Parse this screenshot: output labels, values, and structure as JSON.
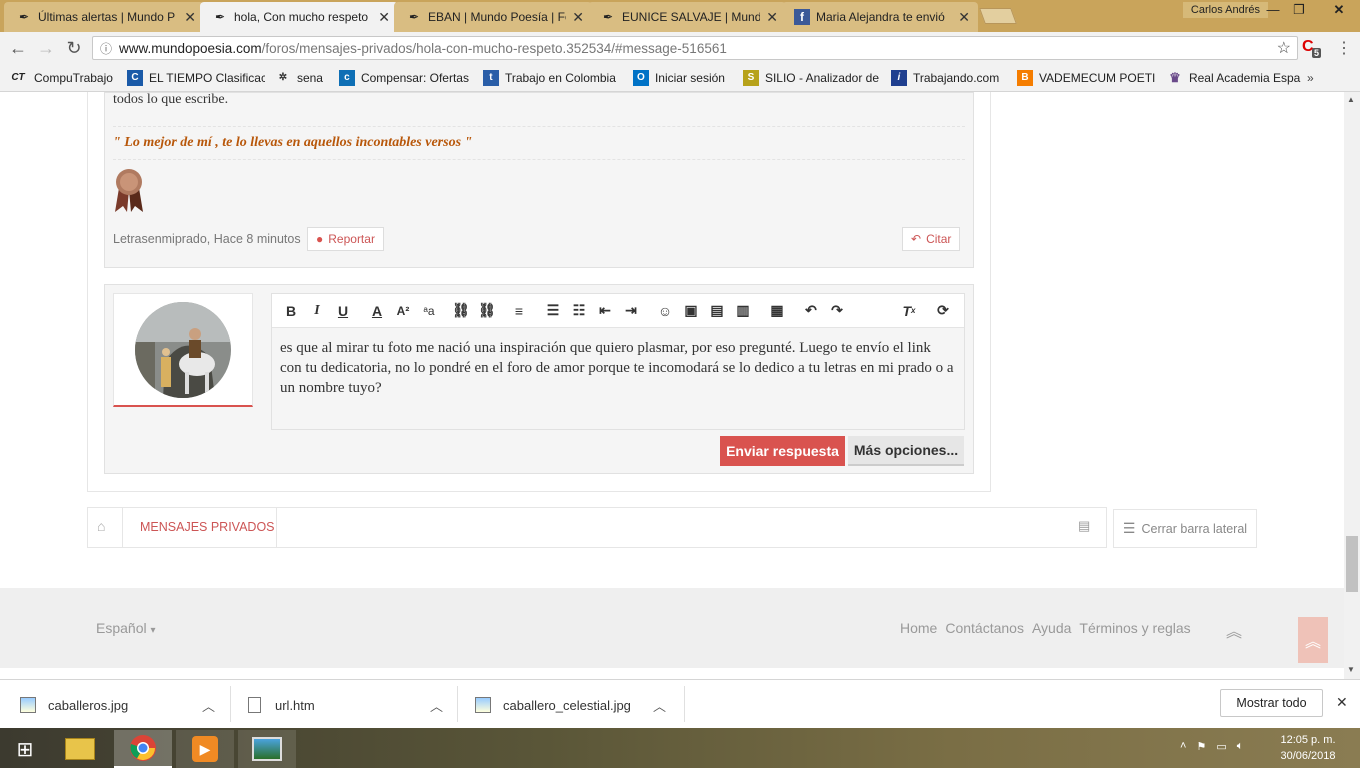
{
  "tabs": [
    {
      "title": "Últimas alertas | Mundo P",
      "icon": "mundo-poesia-icon",
      "active": false
    },
    {
      "title": "hola, Con mucho respeto",
      "icon": "mundo-poesia-icon",
      "active": true
    },
    {
      "title": "EBAN | Mundo Poesía | Fo",
      "icon": "mundo-poesia-icon",
      "active": false
    },
    {
      "title": "EUNICE SALVAJE | Mundo",
      "icon": "mundo-poesia-icon",
      "active": false
    },
    {
      "title": "Maria Alejandra te envió",
      "icon": "facebook-icon",
      "active": false
    }
  ],
  "user": "Carlos Andrés",
  "url": {
    "domain": "www.mundopoesia.com",
    "path": "/foros/mensajes-privados/hola-con-mucho-respeto.352534/#message-516561"
  },
  "extension_badge": "5",
  "bookmarks": [
    {
      "label": "CompuTrabajo",
      "icon": "CT"
    },
    {
      "label": "EL TIEMPO Clasificac",
      "icon": "C"
    },
    {
      "label": "sena",
      "icon": "sena"
    },
    {
      "label": "Compensar: Ofertas",
      "icon": "c"
    },
    {
      "label": "Trabajo en Colombia",
      "icon": "t"
    },
    {
      "label": "Iniciar sesión",
      "icon": "O"
    },
    {
      "label": "SILIO - Analizador de",
      "icon": "S"
    },
    {
      "label": "Trabajando.com",
      "icon": "i"
    },
    {
      "label": "VADEMECUM POETI",
      "icon": "B"
    },
    {
      "label": "Real Academia Espa",
      "icon": "R"
    }
  ],
  "post": {
    "text_tail": "todos lo que escribe.",
    "signature": "\" Lo mejor de mí , te lo llevas en aquellos incontables versos \"",
    "meta": "Letrasenmiprado, Hace 8 minutos",
    "report": "Reportar",
    "quote": "Citar"
  },
  "reply": {
    "text": "es que al mirar tu foto me nació una inspiración que quiero plasmar, por eso pregunté. Luego te envío el link con tu dedicatoria, no lo pondré en el foro de amor porque te incomodará se lo dedico a tu letras en mi prado o a un nombre tuyo?",
    "send": "Enviar respuesta",
    "more": "Más opciones..."
  },
  "breadcrumb": {
    "item": "MENSAJES PRIVADOS"
  },
  "sidebar_toggle": "Cerrar barra lateral",
  "footer": {
    "language": "Español",
    "links": [
      "Home",
      "Contáctanos",
      "Ayuda",
      "Términos y reglas"
    ]
  },
  "downloads": [
    {
      "name": "caballeros.jpg"
    },
    {
      "name": "url.htm"
    },
    {
      "name": "caballero_celestial.jpg"
    }
  ],
  "show_all": "Mostrar todo",
  "clock": {
    "time": "12:05 p. m.",
    "date": "30/06/2018"
  }
}
